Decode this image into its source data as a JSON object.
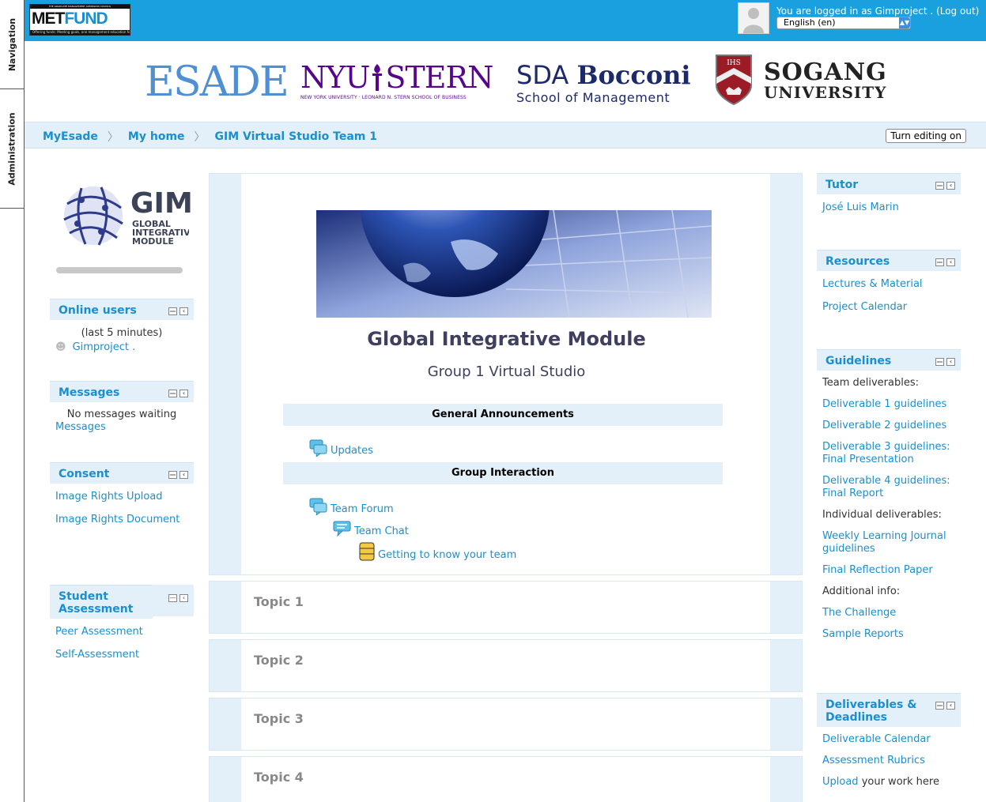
{
  "dock": {
    "navigation": "Navigation",
    "administration": "Administration"
  },
  "header": {
    "metfund_strip": "THE GRADUATE MANAGEMENT ADMISSION COUNCIL",
    "metfund_logo_a": "MET",
    "metfund_logo_b": "FUND",
    "metfund_tagline": "Offering funds: Meeting goals, one management education forward at",
    "login_prefix": "You are logged in as ",
    "login_user": "Gimproject .",
    "login_logout": "(Log out)",
    "language": "English (en)"
  },
  "logos": {
    "esade": "ESADE",
    "nyu_main": "NYU",
    "nyu_stern": "STERN",
    "nyu_sub": "NEW YORK UNIVERSITY · LEONARD N. STERN SCHOOL OF BUSINESS",
    "bocconi_sda": "SDA",
    "bocconi_name": "Bocconi",
    "bocconi_sub": "School of Management",
    "sogang_shield": "IHS",
    "sogang_l1": "SOGANG",
    "sogang_l2": "UNIVERSITY"
  },
  "breadcrumb": [
    "MyEsade",
    "My home",
    "GIM Virtual Studio Team 1"
  ],
  "edit_button": "Turn editing on",
  "gim_logo": {
    "title": "GIM",
    "line1": "GLOBAL",
    "line2": "INTEGRATIVE",
    "line3": "MODULE"
  },
  "left": {
    "online": {
      "title": "Online users",
      "note": "(last 5 minutes)",
      "user": "Gimproject ."
    },
    "messages": {
      "title": "Messages",
      "note": "No messages waiting",
      "link": "Messages"
    },
    "consent": {
      "title": "Consent",
      "items": [
        "Image Rights Upload",
        "Image Rights Document"
      ]
    },
    "assessment": {
      "title": "Student Assessment",
      "items": [
        "Peer Assessment",
        "Self-Assessment"
      ]
    }
  },
  "center": {
    "title": "Global Integrative Module",
    "subtitle": "Group 1 Virtual Studio",
    "general": "General Announcements",
    "updates": "Updates",
    "group": "Group Interaction",
    "forum": "Team Forum",
    "chat": "Team Chat",
    "know": "Getting to know your team",
    "topics": [
      "Topic 1",
      "Topic 2",
      "Topic 3",
      "Topic 4"
    ]
  },
  "right": {
    "tutor": {
      "title": "Tutor",
      "name": "José Luis Marin"
    },
    "resources": {
      "title": "Resources",
      "items": [
        "Lectures & Material",
        "Project Calendar"
      ]
    },
    "guidelines": {
      "title": "Guidelines",
      "team_label": "Team deliverables:",
      "d1": "Deliverable 1 guidelines",
      "d2": "Deliverable 2 guidelines",
      "d3": "Deliverable 3 guidelines: Final Presentation",
      "d4": "Deliverable 4 guidelines: Final Report",
      "indiv_label": "Individual deliverables:",
      "journal": "Weekly Learning Journal guidelines",
      "reflection": "Final Reflection Paper",
      "additional_label": "Additional info:",
      "challenge": "The Challenge",
      "samples": "Sample Reports"
    },
    "deadlines": {
      "title": "Deliverables & Deadlines",
      "calendar": "Deliverable Calendar",
      "rubrics": "Assessment Rubrics",
      "upload_link": "Upload",
      "upload_rest": " your work here"
    }
  },
  "colors": {
    "topbar": "#1aa0de",
    "link": "#1a8fd0",
    "band": "#e3f0f9"
  }
}
